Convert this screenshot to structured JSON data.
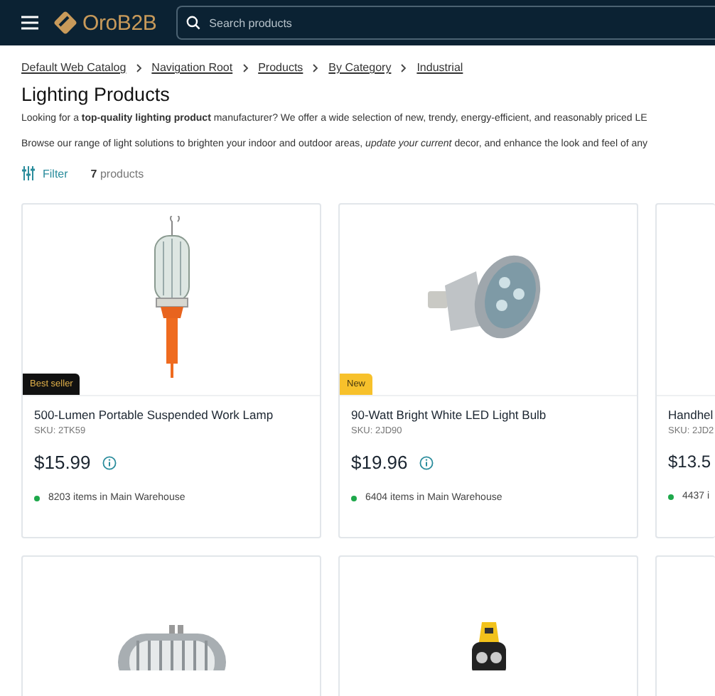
{
  "header": {
    "logo_text": "OroB2B",
    "search": {
      "placeholder": "Search products"
    }
  },
  "breadcrumbs": [
    "Default Web Catalog",
    "Navigation Root",
    "Products",
    "By Category",
    "Industrial"
  ],
  "title": "Lighting Products",
  "description": [
    "Looking for a **top-quality lighting product** manufacturer? We offer a wide selection of new, trendy, energy-efficient, and reasonably priced LE",
    "Browse our range of light solutions to brighten your indoor and outdoor areas, *update your current* decor, and enhance the look and feel of any"
  ],
  "filter": {
    "label": "Filter"
  },
  "count": "**7** products",
  "products": [
    {
      "badge": {
        "text": "Best seller",
        "kind": "bestseller"
      },
      "name": "500-Lumen Portable Suspended Work Lamp",
      "sku": "SKU: 2TK59",
      "price": "$15.99",
      "stock": "8203 items in Main Warehouse",
      "in_stock": true
    },
    {
      "badge": {
        "text": "New",
        "kind": "new"
      },
      "name": "90-Watt Bright White LED Light Bulb",
      "sku": "SKU: 2JD90",
      "price": "$19.96",
      "stock": "6404 items in Main Warehouse",
      "in_stock": true
    },
    {
      "name": "Handhel",
      "sku": "SKU: 2JD2",
      "price": "$13.5",
      "stock": "4437 i",
      "in_stock": true
    }
  ]
}
